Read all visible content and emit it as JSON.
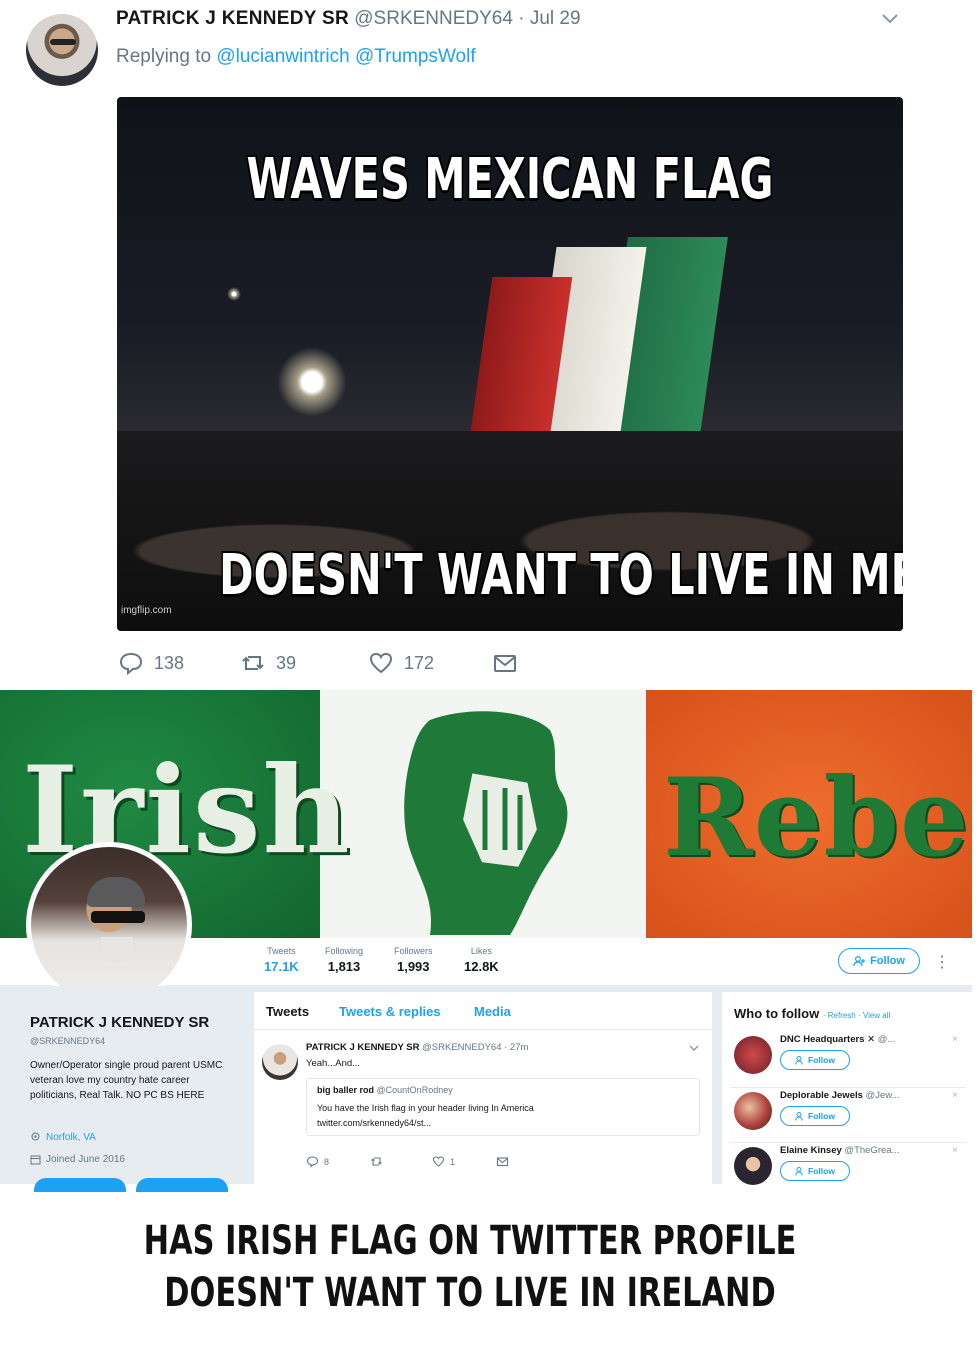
{
  "tweet": {
    "name": "PATRICK J KENNEDY SR",
    "handle": "@SRKENNEDY64",
    "separator": "·",
    "date": "Jul 29",
    "replying_prefix": "Replying to",
    "mentions": [
      "@lucianwintrich",
      "@TrumpsWolf"
    ],
    "meme": {
      "top_text": "WAVES MEXICAN FLAG",
      "bottom_text": "DOESN'T WANT TO LIVE IN MEXICO",
      "watermark": "imgflip.com"
    },
    "actions": {
      "replies": "138",
      "retweets": "39",
      "likes": "172"
    }
  },
  "profile": {
    "banner": {
      "left_word": "Irish",
      "right_word": "Rebel"
    },
    "stats": [
      {
        "label": "Tweets",
        "value": "17.1K"
      },
      {
        "label": "Following",
        "value": "1,813"
      },
      {
        "label": "Followers",
        "value": "1,993"
      },
      {
        "label": "Likes",
        "value": "12.8K"
      }
    ],
    "follow_label": "Follow",
    "name": "PATRICK J KENNEDY SR",
    "handle": "@SRKENNEDY64",
    "bio": "Owner/Operator single proud parent USMC veteran love my country hate career politicians, Real Talk. NO PC BS HERE",
    "location": "Norfolk, VA",
    "joined": "Joined June 2016",
    "tabs": [
      "Tweets",
      "Tweets & replies",
      "Media"
    ],
    "timeline_tweet": {
      "name": "PATRICK J KENNEDY SR",
      "handle": "@SRKENNEDY64",
      "time": "· 27m",
      "text": "Yeah...And...",
      "quote": {
        "name": "big baller rod",
        "handle": "@CountOnRodney",
        "line1": "You have the Irish flag in your header living In America",
        "line2": "twitter.com/srkennedy64/st..."
      },
      "replies": "8",
      "likes": "1"
    },
    "who_to_follow": {
      "title": "Who to follow",
      "refresh": "Refresh",
      "view_all": "View all",
      "follow_label": "Follow",
      "accounts": [
        {
          "name": "DNC Headquarters",
          "handle": "@...",
          "avatar_color": "#8a2e3b"
        },
        {
          "name": "Deplorable Jewels",
          "handle": "@Jew...",
          "avatar_color": "#b0433e"
        },
        {
          "name": "Elaine Kinsey",
          "handle": "@TheGrea...",
          "avatar_color": "#3d3d4a"
        }
      ]
    }
  },
  "caption": {
    "line1": "HAS IRISH FLAG ON TWITTER PROFILE",
    "line2": "DOESN'T WANT TO LIVE IN IRELAND"
  },
  "colors": {
    "accent": "#1da1f2",
    "muted": "#657786",
    "irish_green": "#169b62",
    "irish_orange": "#ff883e"
  }
}
